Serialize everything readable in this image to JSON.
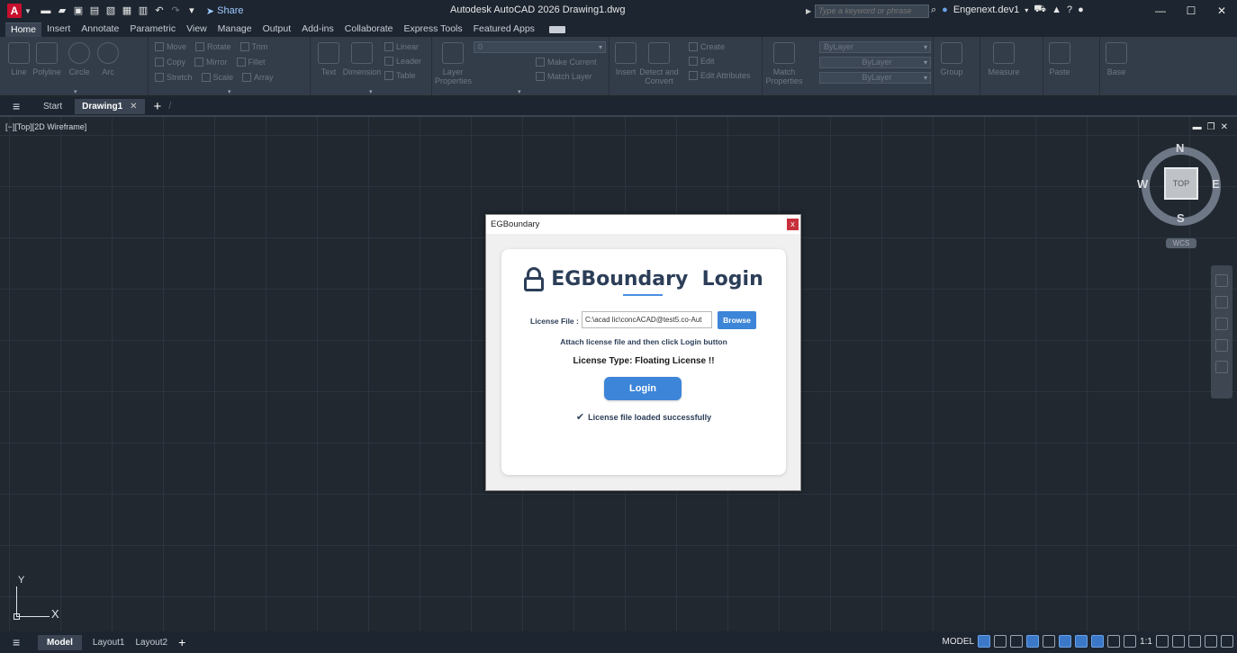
{
  "titlebar": {
    "app_letter": "A",
    "share_label": "Share",
    "title": "Autodesk AutoCAD 2026   Drawing1.dwg",
    "search_placeholder": "Type a keyword or phrase",
    "user": "Engenext.dev1"
  },
  "ribbon_tabs": [
    "Home",
    "Insert",
    "Annotate",
    "Parametric",
    "View",
    "Manage",
    "Output",
    "Add-ins",
    "Collaborate",
    "Express Tools",
    "Featured Apps"
  ],
  "ribbon": {
    "draw": [
      "Line",
      "Polyline",
      "Circle",
      "Arc"
    ],
    "modify_row1": [
      "Move",
      "Rotate",
      "Trim"
    ],
    "modify_row2": [
      "Copy",
      "Mirror",
      "Fillet"
    ],
    "modify_row3": [
      "Stretch",
      "Scale",
      "Array"
    ],
    "annotation": {
      "text": "Text",
      "dimension": "Dimension",
      "linear": "Linear",
      "leader": "Leader",
      "table": "Table"
    },
    "layers": {
      "props": "Layer Properties",
      "current": "0",
      "make_current": "Make Current",
      "match_layer": "Match Layer"
    },
    "block": {
      "insert": "Insert",
      "detect": "Detect and Convert",
      "create": "Create",
      "edit": "Edit",
      "edit_attr": "Edit Attributes"
    },
    "properties": {
      "match": "Match Properties",
      "bylayer1": "ByLayer",
      "bylayer2": "ByLayer",
      "bylayer3": "ByLayer"
    },
    "groups": {
      "group": "Group"
    },
    "utilities": {
      "measure": "Measure"
    },
    "clipboard": {
      "paste": "Paste"
    },
    "view": {
      "base": "Base"
    }
  },
  "filetabs": {
    "start": "Start",
    "drawing": "Drawing1"
  },
  "viewport": {
    "label": "[−][Top][2D Wireframe]",
    "cube_top": "TOP",
    "n": "N",
    "s": "S",
    "e": "E",
    "w": "W",
    "wcs": "WCS"
  },
  "ucs": {
    "x": "X",
    "y": "Y"
  },
  "status": {
    "model": "Model",
    "layout1": "Layout1",
    "layout2": "Layout2",
    "model_right": "MODEL",
    "scale": "1:1"
  },
  "dialog": {
    "title": "EGBoundary",
    "close": "x",
    "heading": "EGBoundary  Login",
    "license_label": "License File :",
    "license_value": "C:\\acad lic\\concACAD@test5.co-Aut",
    "browse": "Browse",
    "hint": "Attach license file and then click Login button",
    "license_type": "License Type: Floating License !!",
    "login": "Login",
    "success": "License file loaded successfully"
  }
}
